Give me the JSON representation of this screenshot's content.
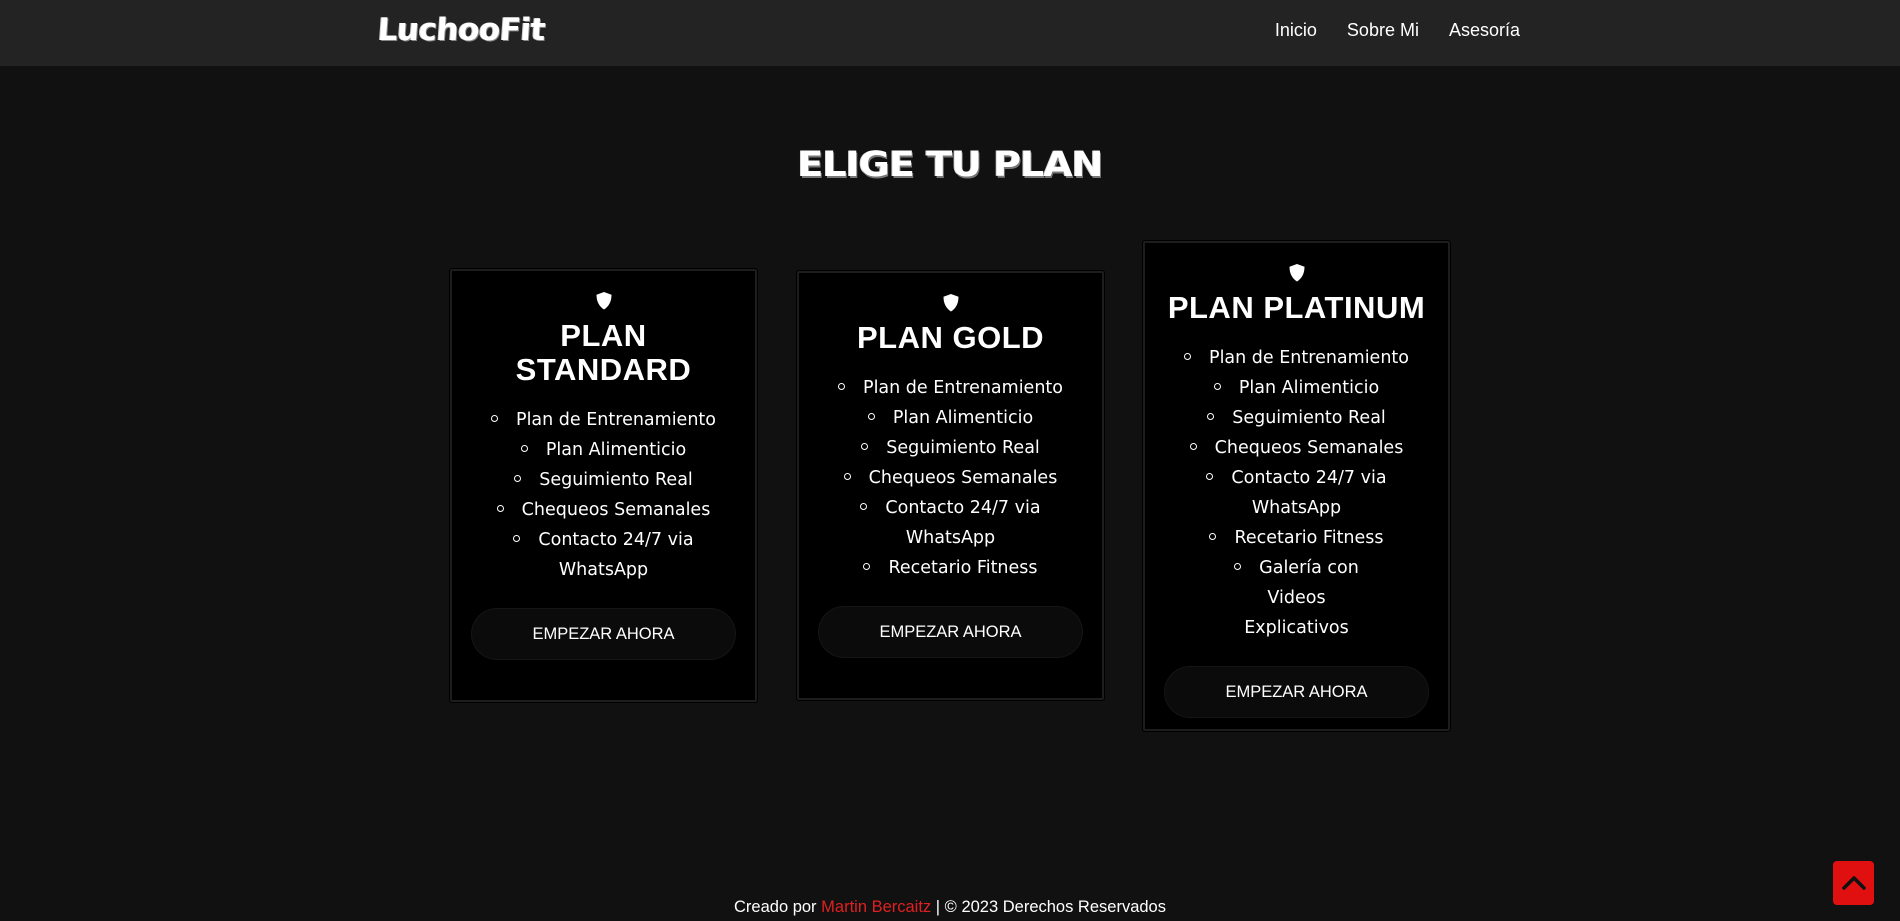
{
  "header": {
    "logo": "LuchooFit",
    "nav": [
      {
        "label": "Inicio"
      },
      {
        "label": "Sobre Mi"
      },
      {
        "label": "Asesoría"
      }
    ]
  },
  "pricing": {
    "title": "ELIGE TU PLAN",
    "plans": [
      {
        "icon": "shield-icon",
        "name": "PLAN STANDARD",
        "features": [
          "Plan de Entrenamiento",
          "Plan Alimenticio",
          "Seguimiento Real",
          "Chequeos Semanales",
          "Contacto 24/7 via WhatsApp"
        ],
        "button": "EMPEZAR AHORA"
      },
      {
        "icon": "shield-icon",
        "name": "PLAN GOLD",
        "features": [
          "Plan de Entrenamiento",
          "Plan Alimenticio",
          "Seguimiento Real",
          "Chequeos Semanales",
          "Contacto 24/7 via WhatsApp",
          "Recetario Fitness"
        ],
        "button": "EMPEZAR AHORA"
      },
      {
        "icon": "shield-icon",
        "name": "PLAN PLATINUM",
        "features": [
          "Plan de Entrenamiento",
          "Plan Alimenticio",
          "Seguimiento Real",
          "Chequeos Semanales",
          "Contacto 24/7 via WhatsApp",
          "Recetario Fitness",
          "Galería con Videos Explicativos"
        ],
        "button": "EMPEZAR AHORA"
      }
    ]
  },
  "footer": {
    "prefix": "Creado por",
    "author": "Martin Bercaitz",
    "separator": "|",
    "copyright_symbol": "©",
    "suffix": "2023 Derechos Reservados"
  },
  "scroll_top": {
    "icon": "chevron-up-icon"
  },
  "colors": {
    "background": "#111111",
    "navbar": "#232323",
    "card": "#000000",
    "accent": "#e01010"
  }
}
